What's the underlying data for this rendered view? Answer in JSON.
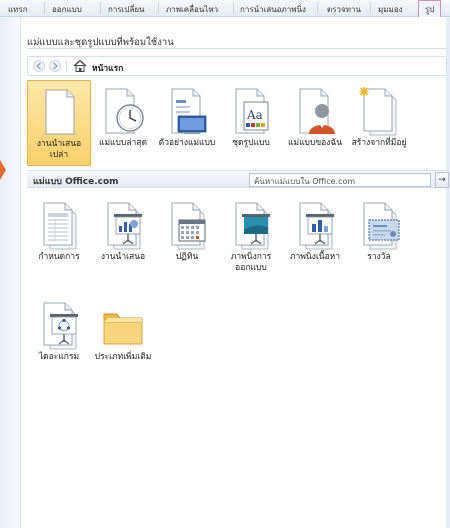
{
  "ribbon": {
    "tabs": [
      "แทรก",
      "ออกแบบ",
      "การเปลี่ยน",
      "ภาพเคลื่อนไหว",
      "การนำเสนอภาพนิ่ง",
      "ตรวจทาน",
      "มุมมอง",
      "รูป"
    ]
  },
  "panel": {
    "heading": "แม่แบบและชุดรูปแบบที่พร้อมใช้งาน",
    "nav_home_label": "หน้าแรก"
  },
  "available_templates": [
    {
      "label": "งานนำเสนอเปล่า",
      "icon": "blank-document-icon",
      "selected": true
    },
    {
      "label": "แม่แบบล่าสุด",
      "icon": "clock-document-icon"
    },
    {
      "label": "ตัวอย่างแม่แบบ",
      "icon": "sample-templates-icon"
    },
    {
      "label": "ชุดรูปแบบ",
      "icon": "themes-icon"
    },
    {
      "label": "แม่แบบของฉัน",
      "icon": "user-document-icon"
    },
    {
      "label": "สร้างจากที่มีอยู่",
      "icon": "new-from-existing-icon"
    }
  ],
  "office": {
    "label": "แม่แบบ Office.com",
    "search_placeholder": "ค้นหาแม่แบบใน Office.com",
    "search_button": "→"
  },
  "office_templates": [
    {
      "label": "กำหนดการ",
      "icon": "agenda-icon"
    },
    {
      "label": "งานนำเสนอ",
      "icon": "presentation-icon"
    },
    {
      "label": "ปฏิทิน",
      "icon": "calendar-icon"
    },
    {
      "label": "ภาพนิ่งการออกแบบ",
      "icon": "design-slides-icon"
    },
    {
      "label": "ภาพนิ่งเนื้อหา",
      "icon": "content-slides-icon"
    },
    {
      "label": "รางวัล",
      "icon": "award-icon"
    },
    {
      "label": "ไดอะแกรม",
      "icon": "diagram-icon"
    },
    {
      "label": "ประเภทเพิ่มเติม",
      "icon": "folder-icon"
    }
  ],
  "colors": {
    "selected_tile": "#f9d06a",
    "accent_tab": "#d48fb8"
  }
}
